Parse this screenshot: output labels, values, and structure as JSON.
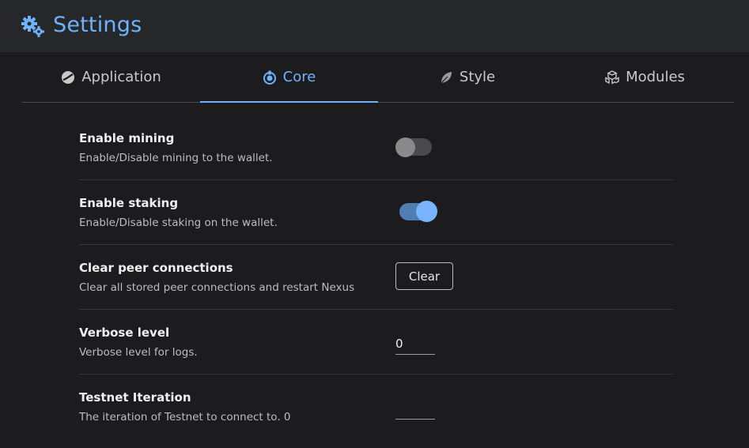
{
  "header": {
    "title": "Settings",
    "icon": "gears-icon"
  },
  "tabs": [
    {
      "label": "Application",
      "icon": "application-icon",
      "active": false
    },
    {
      "label": "Core",
      "icon": "core-icon",
      "active": true
    },
    {
      "label": "Style",
      "icon": "leaf-icon",
      "active": false
    },
    {
      "label": "Modules",
      "icon": "cubes-icon",
      "active": false
    }
  ],
  "settings": {
    "mining": {
      "label": "Enable mining",
      "desc": "Enable/Disable mining to the wallet.",
      "enabled": false
    },
    "staking": {
      "label": "Enable staking",
      "desc": "Enable/Disable staking on the wallet.",
      "enabled": true
    },
    "peers": {
      "label": "Clear peer connections",
      "desc": "Clear all stored peer connections and restart Nexus",
      "button": "Clear"
    },
    "verbose": {
      "label": "Verbose level",
      "desc": "Verbose level for logs.",
      "value": "0"
    },
    "testnet": {
      "label": "Testnet Iteration",
      "desc": "The iteration of Testnet to connect to. 0",
      "value": ""
    }
  },
  "colors": {
    "accent": "#6fb2ff",
    "background": "#1c1c1e",
    "header": "#262729"
  }
}
